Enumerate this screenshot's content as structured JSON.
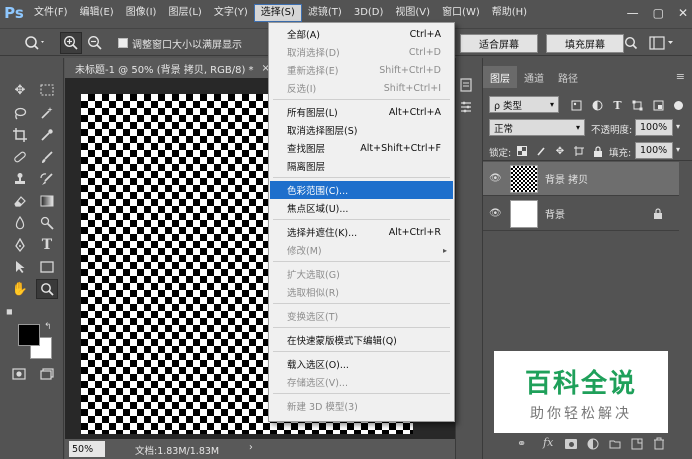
{
  "menubar": {
    "logo": "Ps",
    "items": [
      "文件(F)",
      "编辑(E)",
      "图像(I)",
      "图层(L)",
      "文字(Y)",
      "选择(S)",
      "滤镜(T)",
      "3D(D)",
      "视图(V)",
      "窗口(W)",
      "帮助(H)"
    ],
    "active_index": 5,
    "window_controls": [
      "—",
      "▢",
      "✕"
    ]
  },
  "optbar": {
    "resize_windows_label": "调整窗口大小以满屏显示",
    "fit_screen_label": "适合屏幕",
    "fill_screen_label": "填充屏幕"
  },
  "document": {
    "tab_title": "未标题-1 @ 50% (背景 拷贝, RGB/8) *",
    "tab_close": "×",
    "zoom": "50%",
    "doc_info": "文档:1.83M/1.83M"
  },
  "dropdown": {
    "items": [
      {
        "label": "全部(A)",
        "shortcut": "Ctrl+A",
        "disabled": false
      },
      {
        "label": "取消选择(D)",
        "shortcut": "Ctrl+D",
        "disabled": true
      },
      {
        "label": "重新选择(E)",
        "shortcut": "Shift+Ctrl+D",
        "disabled": true
      },
      {
        "label": "反选(I)",
        "shortcut": "Shift+Ctrl+I",
        "disabled": true
      },
      {
        "label": "所有图层(L)",
        "shortcut": "Alt+Ctrl+A",
        "disabled": false
      },
      {
        "label": "取消选择图层(S)",
        "shortcut": "",
        "disabled": false
      },
      {
        "label": "查找图层",
        "shortcut": "Alt+Shift+Ctrl+F",
        "disabled": false
      },
      {
        "label": "隔离图层",
        "shortcut": "",
        "disabled": false
      },
      {
        "label": "色彩范围(C)...",
        "shortcut": "",
        "disabled": false,
        "highlighted": true
      },
      {
        "label": "焦点区域(U)...",
        "shortcut": "",
        "disabled": false
      },
      {
        "label": "选择并遮住(K)...",
        "shortcut": "Alt+Ctrl+R",
        "disabled": false
      },
      {
        "label": "修改(M)",
        "shortcut": "",
        "disabled": true,
        "submenu": true
      },
      {
        "label": "扩大选取(G)",
        "shortcut": "",
        "disabled": true
      },
      {
        "label": "选取相似(R)",
        "shortcut": "",
        "disabled": true
      },
      {
        "label": "变换选区(T)",
        "shortcut": "",
        "disabled": true
      },
      {
        "label": "在快速蒙版模式下编辑(Q)",
        "shortcut": "",
        "disabled": false
      },
      {
        "label": "载入选区(O)...",
        "shortcut": "",
        "disabled": false
      },
      {
        "label": "存储选区(V)...",
        "shortcut": "",
        "disabled": true
      },
      {
        "label": "新建 3D 模型(3)",
        "shortcut": "",
        "disabled": true
      }
    ]
  },
  "layers_panel": {
    "tabs": [
      "图层",
      "通道",
      "路径"
    ],
    "active_tab": 0,
    "kind_filter": "ρ 类型",
    "blend_mode": "正常",
    "opacity_label": "不透明度:",
    "opacity_value": "100%",
    "lock_label": "锁定:",
    "fill_label": "填充:",
    "fill_value": "100%",
    "layers": [
      {
        "name": "背景 拷贝",
        "selected": true
      },
      {
        "name": "背景",
        "selected": false
      }
    ]
  },
  "watermark": {
    "title": "百科全说",
    "subtitle": "助你轻松解决"
  }
}
